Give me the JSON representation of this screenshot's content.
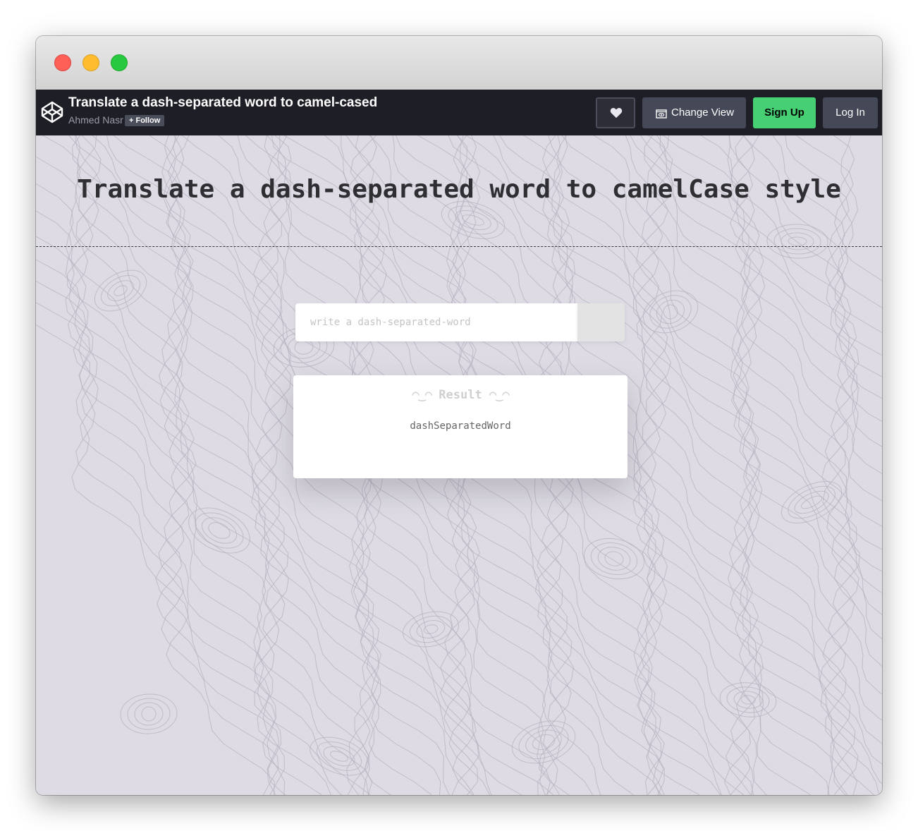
{
  "window": {
    "controls": [
      "close",
      "minimize",
      "zoom"
    ]
  },
  "header": {
    "pen_title": "Translate a dash-separated word to camel-cased",
    "author": "Ahmed Nasr",
    "follow_label": "+ Follow",
    "change_view_label": "Change View",
    "signup_label": "Sign Up",
    "login_label": "Log In",
    "icons": [
      "codepen-logo-icon",
      "heart-icon",
      "change-view-icon"
    ]
  },
  "main": {
    "heading": "Translate a dash-separated word to camelCase style",
    "input": {
      "placeholder": "write a dash-separated-word",
      "value": ""
    },
    "convert_glyph": "",
    "result": {
      "face_left": "◠‿◠",
      "title": "Result",
      "face_right": "◠‿◠",
      "value": "dashSeparatedWord"
    }
  },
  "colors": {
    "header_bg": "#1e1f26",
    "signup_green": "#47cf73",
    "button_gray": "#444857",
    "page_bg": "#dedbe4"
  }
}
